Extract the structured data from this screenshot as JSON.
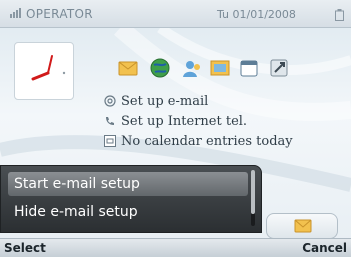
{
  "status_bar": {
    "operator": "OPERATOR",
    "datetime": "Tu 01/01/2008"
  },
  "shortcuts": [
    {
      "name": "messaging",
      "icon": "envelope-icon"
    },
    {
      "name": "web",
      "icon": "globe-icon"
    },
    {
      "name": "contacts",
      "icon": "contacts-icon"
    },
    {
      "name": "gallery",
      "icon": "gallery-icon"
    },
    {
      "name": "calendar",
      "icon": "calendar-icon"
    },
    {
      "name": "settings",
      "icon": "tools-icon"
    }
  ],
  "info_lines": [
    {
      "icon": "at-sign-icon",
      "text": "Set up e-mail"
    },
    {
      "icon": "internet-tel-icon",
      "text": "Set up Internet tel."
    },
    {
      "icon": "calendar-small-icon",
      "text": "No calendar entries today"
    }
  ],
  "menu": {
    "items": [
      "Start e-mail setup",
      "Hide e-mail setup"
    ],
    "selected_index": 0
  },
  "softkeys": {
    "left": "Select",
    "right": "Cancel"
  },
  "colors": {
    "menu_bg": "#2b2f32",
    "menu_highlight": "#7a7f83",
    "clock_hand": "#d11a1a",
    "text_dark": "#2f3d47"
  }
}
